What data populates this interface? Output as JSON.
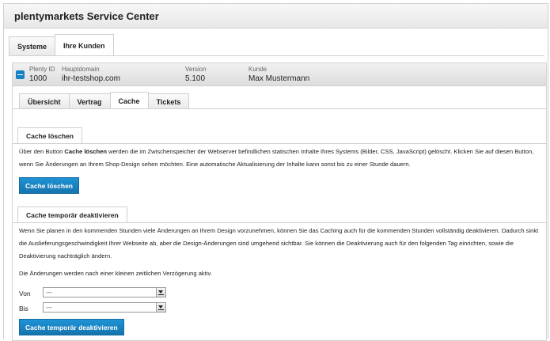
{
  "app": {
    "title": "plentymarkets Service Center"
  },
  "main_tabs": [
    {
      "label": "Systeme",
      "active": false
    },
    {
      "label": "Ihre Kunden",
      "active": true
    }
  ],
  "customer": {
    "plenty_id_label": "Plenty ID",
    "plenty_id": "1000",
    "domain_label": "Hauptdomain",
    "domain": "ihr-testshop.com",
    "version_label": "Version",
    "version": "5.100",
    "customer_label": "Kunde",
    "customer_name": "Max Mustermann"
  },
  "sub_tabs": [
    {
      "label": "Übersicht",
      "active": false
    },
    {
      "label": "Vertrag",
      "active": false
    },
    {
      "label": "Cache",
      "active": true
    },
    {
      "label": "Tickets",
      "active": false
    }
  ],
  "cache_clear": {
    "title": "Cache löschen",
    "text_before": "Über den Button ",
    "text_bold": "Cache löschen",
    "text_after": " werden die im Zwischenspeicher der Webserver befindlichen statischen Inhalte Ihres Systems (Bilder, CSS, JavaScript) gelöscht. Klicken Sie auf diesen Button, wenn Sie Änderungen an Ihrem Shop-Design sehen möchten. Eine automatische Aktualisierung der Inhalte kann sonst bis zu einer Stunde dauern.",
    "button_label": "Cache löschen"
  },
  "cache_disable": {
    "title": "Cache temporär deaktivieren",
    "paragraph1": "Wenn Sie planen in den kommenden Stunden viele Änderungen an Ihrem Design vorzunehmen, können Sie das Caching auch für die kommenden Stunden vollständig deaktivieren. Dadurch sinkt die Auslieferungsgeschwindigkeit Ihrer Webseite ab, aber die Design-Änderungen sind umgehend sichtbar. Sie können die Deaktivierung auch für den folgenden Tag einrichten, sowie die Deaktivierung nachträglich ändern.",
    "paragraph2": "Die Änderungen werden nach einer kleinen zeitlichen Verzögerung aktiv.",
    "from_label": "Von",
    "from_value": "---",
    "to_label": "Bis",
    "to_value": "---",
    "button_label": "Cache temporär deaktivieren"
  },
  "colors": {
    "accent": "#1781c4",
    "border": "#cfcfcf"
  }
}
